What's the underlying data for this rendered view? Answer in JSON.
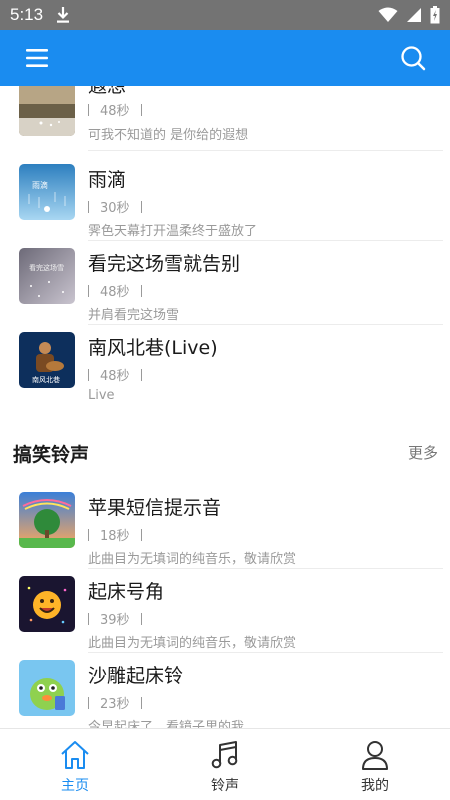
{
  "status_bar": {
    "time": "5:13"
  },
  "colors": {
    "accent": "#1a8cf0",
    "status_bar": "#737373",
    "muted_text": "#9a9a9a"
  },
  "header": {
    "menu_icon": "menu-icon",
    "search_icon": "search-icon"
  },
  "songs_top": [
    {
      "title": "遐想",
      "duration": "48秒",
      "desc": "可我不知道的 是你给的遐想",
      "cover": "landscape-cover"
    },
    {
      "title": "雨滴",
      "duration": "30秒",
      "desc": "霁色天幕打开温柔终于盛放了",
      "cover": "rain-cover"
    },
    {
      "title": "看完这场雪就告别",
      "duration": "48秒",
      "desc": "并肩看完这场雪",
      "cover": "snow-cover"
    },
    {
      "title": "南风北巷(Live)",
      "duration": "48秒",
      "desc": "Live",
      "cover": "guitar-cover"
    }
  ],
  "section": {
    "title": "搞笑铃声",
    "more": "更多"
  },
  "songs_funny": [
    {
      "title": "苹果短信提示音",
      "duration": "18秒",
      "desc": "此曲目为无填词的纯音乐，敬请欣赏",
      "cover": "tree-cover"
    },
    {
      "title": "起床号角",
      "duration": "39秒",
      "desc": "此曲目为无填词的纯音乐，敬请欣赏",
      "cover": "emoji-cover"
    },
    {
      "title": "沙雕起床铃",
      "duration": "23秒",
      "desc": "今早起床了，看镜子里的我",
      "cover": "cartoon-cover"
    }
  ],
  "nav": [
    {
      "label": "主页",
      "icon": "home-icon",
      "active": true
    },
    {
      "label": "铃声",
      "icon": "music-note-icon",
      "active": false
    },
    {
      "label": "我的",
      "icon": "user-icon",
      "active": false
    }
  ]
}
